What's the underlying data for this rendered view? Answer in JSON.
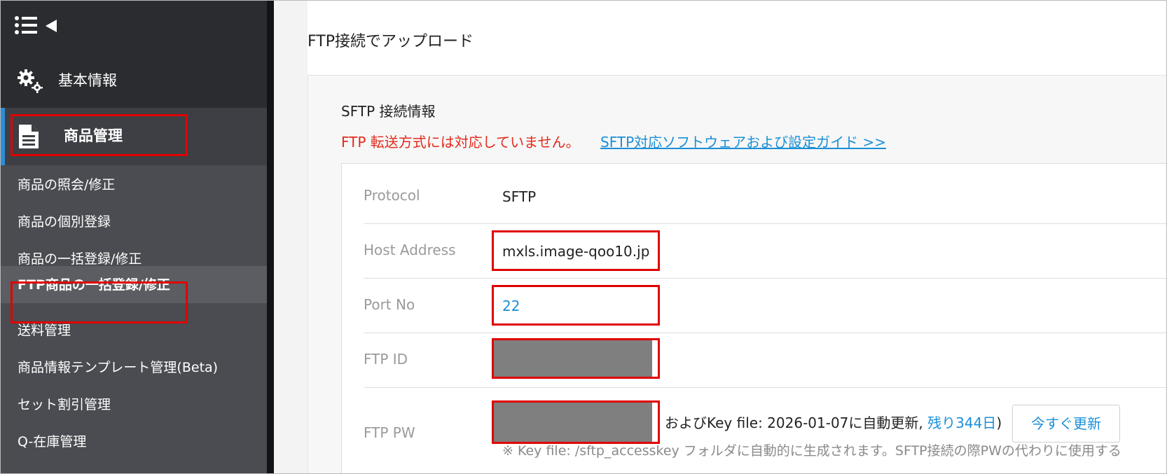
{
  "sidebar": {
    "basic_info": "基本情報",
    "product_management": "商品管理",
    "items": [
      {
        "label": "商品の照会/修正"
      },
      {
        "label": "商品の個別登録"
      },
      {
        "label": "商品の一括登録/修正"
      },
      {
        "label": "FTP商品の一括登録/修正"
      },
      {
        "label": "送料管理"
      },
      {
        "label": "商品情報テンプレート管理(Beta)"
      },
      {
        "label": "セット割引管理"
      },
      {
        "label": "Q-在庫管理"
      }
    ]
  },
  "main": {
    "title": "FTP接続でアップロード",
    "panel_title": "SFTP 接続情報",
    "warning": "FTP 転送方式には対応していません。",
    "guide_link": "SFTP対応ソフトウェアおよび設定ガイド >>",
    "rows": {
      "protocol": {
        "label": "Protocol",
        "value": "SFTP"
      },
      "host": {
        "label": "Host Address",
        "value": "mxls.image-qoo10.jp"
      },
      "port": {
        "label": "Port No",
        "value": "22"
      },
      "ftp_id": {
        "label": "FTP ID"
      },
      "ftp_pw": {
        "label": "FTP PW"
      }
    },
    "pw_tail_prefix": "およびKey file: 2026-01-07に自動更新,",
    "pw_tail_days": "残り344日",
    "pw_tail_suffix": ")",
    "renew_button": "今すぐ更新",
    "note": "※ Key file: /sftp_accesskey フォルダに自動的に生成されます。SFTP接続の際PWの代わりに使用する"
  },
  "colors": {
    "accent": "#2f8cd6",
    "link": "#1a8fd8",
    "warning": "#e32a1b",
    "highlight_box": "#e00000",
    "masked": "#7f7f7f"
  }
}
